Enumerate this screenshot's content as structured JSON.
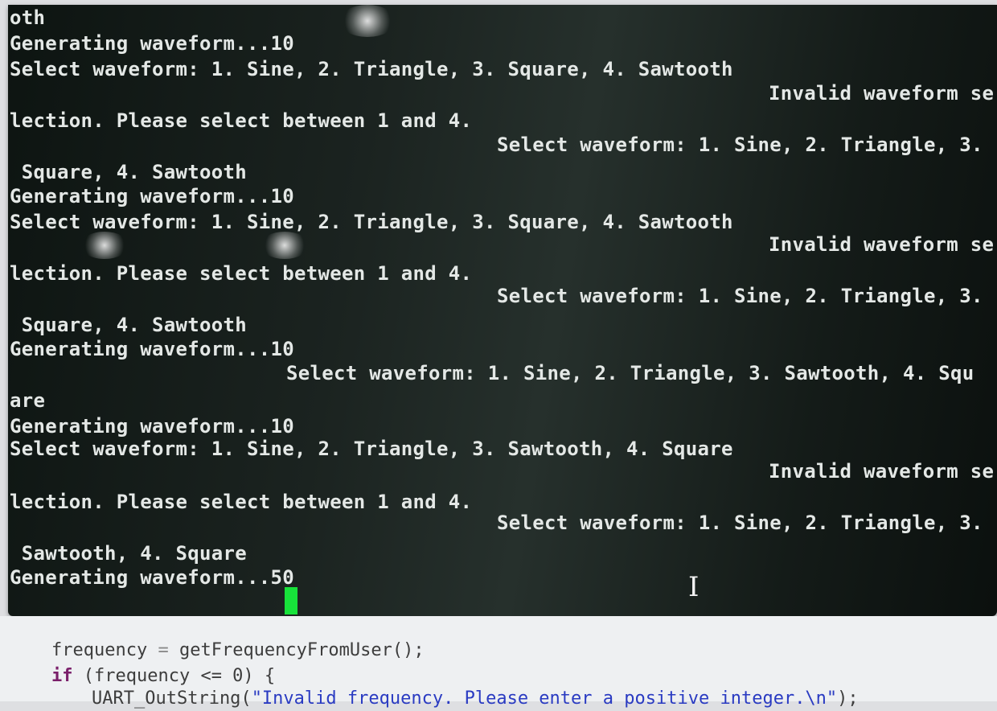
{
  "terminal": {
    "lines": [
      "oth",
      "Generating waveform...10",
      "Select waveform: 1. Sine, 2. Triangle, 3. Square, 4. Sawtooth",
      "Invalid waveform se",
      "lection. Please select between 1 and 4.",
      "Select waveform: 1. Sine, 2. Triangle, 3.",
      " Square, 4. Sawtooth",
      "Generating waveform...10",
      "Select waveform: 1. Sine, 2. Triangle, 3. Square, 4. Sawtooth",
      "Invalid waveform se",
      "lection. Please select between 1 and 4.",
      "Select waveform: 1. Sine, 2. Triangle, 3.",
      " Square, 4. Sawtooth",
      "Generating waveform...10",
      "Select waveform: 1. Sine, 2. Triangle, 3. Sawtooth, 4. Squ",
      "are",
      "Generating waveform...10",
      "Select waveform: 1. Sine, 2. Triangle, 3. Sawtooth, 4. Square",
      "Invalid waveform se",
      "lection. Please select between 1 and 4.",
      "Select waveform: 1. Sine, 2. Triangle, 3.",
      " Sawtooth, 4. Square",
      "Generating waveform...50"
    ],
    "cursor_color": "#17e23a",
    "text_color": "#e4e8e6"
  },
  "editor": {
    "line1_var": "frequency",
    "line1_op": "=",
    "line1_call": "getFrequencyFromUser();",
    "line2_kw": "if",
    "line2_rest": "(frequency <= 0) {",
    "line3_func": "UART_OutString(",
    "line3_str": "\"Invalid frequency. Please enter a positive integer.\\n\"",
    "line3_end": ");"
  },
  "icons": {
    "cursor": "ibeam-cursor-icon"
  }
}
